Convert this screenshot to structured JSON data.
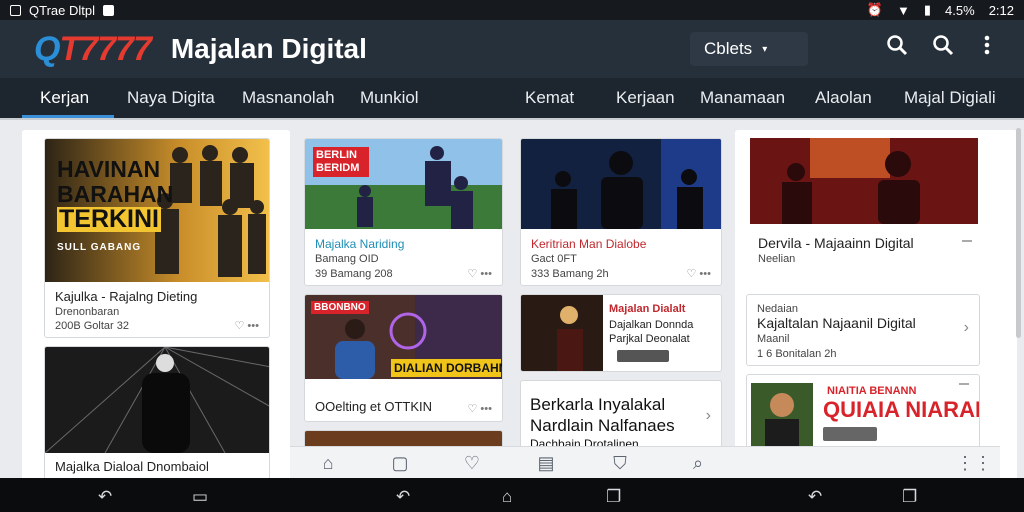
{
  "status": {
    "title": "QTrae Dltpl",
    "battery": "4.5%",
    "time": "2:12"
  },
  "header": {
    "logo_q": "Q",
    "logo_num": "T7777",
    "title": "Majalan Digital",
    "select_value": "Cblets"
  },
  "nav": [
    "Kerjan",
    "Naya Digita",
    "Masnanolah",
    "Munkiol",
    "Kemat",
    "Kerjaan",
    "Manamaan",
    "Alaolan",
    "Majal Digiali"
  ],
  "col1": {
    "card1": {
      "overlay": [
        "HAVINAN",
        "BARAHAN",
        "TERKINI",
        "SULL GABANG"
      ],
      "title": "Kajulka - Rajalng Dieting",
      "sub": "Drenonbaran",
      "meta": "200B Goltar 32"
    },
    "card2": {
      "title": "Majalka Dialoal Dnombaiol"
    }
  },
  "col2": {
    "card1": {
      "badge": "BERLIN BERIDM",
      "title": "Majalka Nariding",
      "sub": "Bamang OID",
      "meta": "39 Bamang 208"
    },
    "card2": {
      "badge": "BBONBNO",
      "overlay": "DIALIAN DORBAHN",
      "title": "OOelting et OTTKIN"
    }
  },
  "col3": {
    "card1": {
      "title": "Keritrian Man Dialobe",
      "sub": "Gact 0FT",
      "meta": "333 Bamang 2h"
    },
    "card2": {
      "title": "Majalan Dialalt",
      "sub": "Dajalkan Donnda",
      "extra": "Parjkal Deonalat"
    },
    "card3": {
      "title": "Berkarla Inyalakal",
      "title2": "Nardlain Nalfanaes",
      "sub": "Dachbain Drotalinen"
    }
  },
  "col4": {
    "card1": {
      "title": "Dervila - Majaainn Digital",
      "sub": "Neelian"
    },
    "card2": {
      "sub": "Nedaian",
      "title": "Kajaltalan Najaanil Digital",
      "sub2": "Maanil",
      "meta": "1 6 Bonitalan 2h"
    },
    "card3": {
      "overlay1": "NIAITIA BENANN",
      "overlay2": "QUIAIA NIARANI"
    }
  },
  "colors": {
    "accent": "#3a8fd6",
    "header": "#26303b",
    "nav": "#1d252e",
    "logo_red": "#e43a2f",
    "badge_red": "#d8232a"
  }
}
